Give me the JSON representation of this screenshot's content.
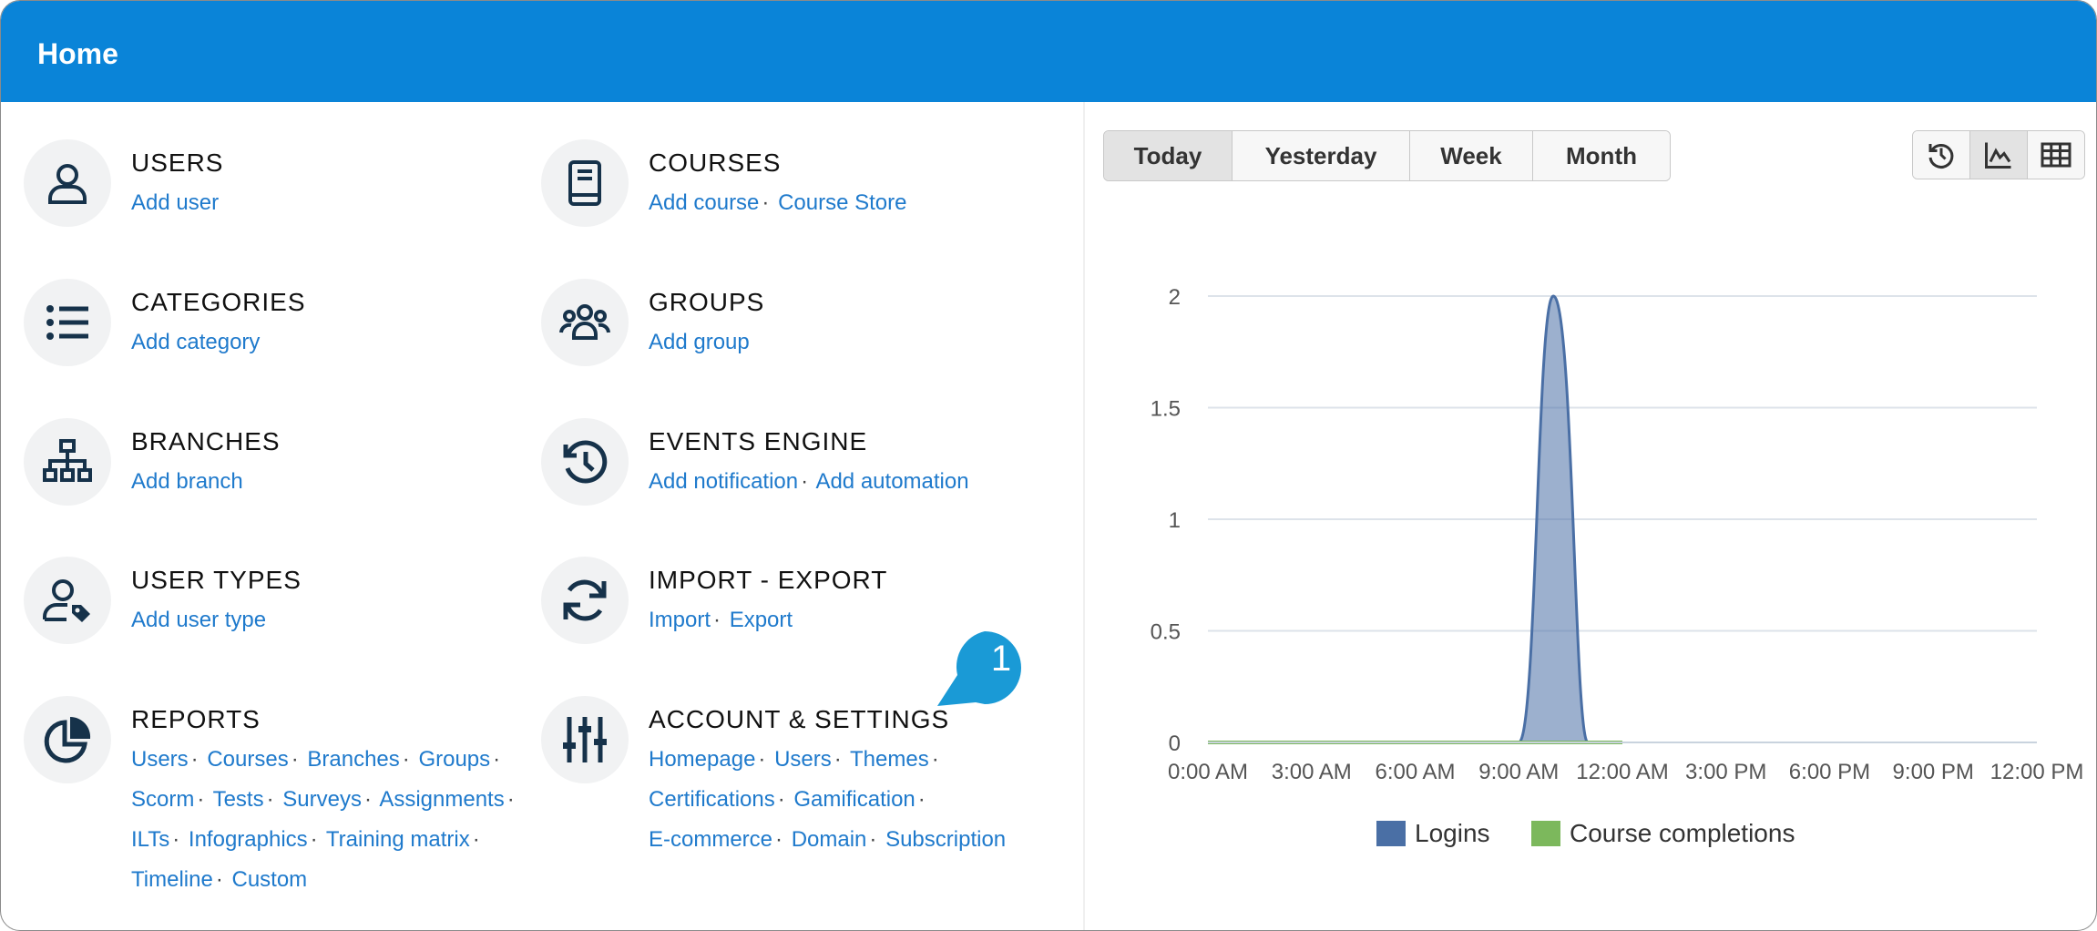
{
  "header": {
    "title": "Home"
  },
  "sections": [
    {
      "key": "users",
      "title": "USERS",
      "icon": "user-icon",
      "links": [
        "Add user"
      ]
    },
    {
      "key": "courses",
      "title": "COURSES",
      "icon": "book-icon",
      "links": [
        "Add course",
        "Course Store"
      ]
    },
    {
      "key": "categories",
      "title": "CATEGORIES",
      "icon": "list-icon",
      "links": [
        "Add category"
      ]
    },
    {
      "key": "groups",
      "title": "GROUPS",
      "icon": "group-icon",
      "links": [
        "Add group"
      ]
    },
    {
      "key": "branches",
      "title": "BRANCHES",
      "icon": "sitemap-icon",
      "links": [
        "Add branch"
      ]
    },
    {
      "key": "events",
      "title": "EVENTS ENGINE",
      "icon": "history-icon",
      "links": [
        "Add notification",
        "Add automation"
      ]
    },
    {
      "key": "usertypes",
      "title": "USER TYPES",
      "icon": "user-tag-icon",
      "links": [
        "Add user type"
      ]
    },
    {
      "key": "importexport",
      "title": "IMPORT - EXPORT",
      "icon": "sync-icon",
      "links": [
        "Import",
        "Export"
      ]
    },
    {
      "key": "reports",
      "title": "REPORTS",
      "icon": "pie-chart-icon",
      "links": [
        "Users",
        "Courses",
        "Branches",
        "Groups",
        "Scorm",
        "Tests",
        "Surveys",
        "Assignments",
        "ILTs",
        "Infographics",
        "Training matrix",
        "Timeline",
        "Custom"
      ]
    },
    {
      "key": "account",
      "title": "ACCOUNT & SETTINGS",
      "icon": "sliders-icon",
      "links": [
        "Homepage",
        "Users",
        "Themes",
        "Certifications",
        "Gamification",
        "E-commerce",
        "Domain",
        "Subscription"
      ]
    }
  ],
  "callout": {
    "number": "1",
    "color": "#1a9ad6"
  },
  "period_tabs": [
    "Today",
    "Yesterday",
    "Week",
    "Month"
  ],
  "active_period": "Today",
  "view_buttons": [
    {
      "icon": "history-icon",
      "active": false
    },
    {
      "icon": "area-chart-icon",
      "active": true
    },
    {
      "icon": "table-icon",
      "active": false
    }
  ],
  "colors": {
    "header": "#0a84d8",
    "link": "#1f7acc",
    "logins": "#4a6fa5",
    "completions": "#7cb85c"
  },
  "chart_data": {
    "type": "area",
    "x": [
      "0:00 AM",
      "3:00 AM",
      "6:00 AM",
      "9:00 AM",
      "12:00 AM",
      "3:00 PM",
      "6:00 PM",
      "9:00 PM",
      "12:00 PM"
    ],
    "yticks": [
      "0",
      "0.5",
      "1",
      "1.5",
      "2"
    ],
    "ylim": [
      0,
      2
    ],
    "grid": true,
    "legend_position": "bottom",
    "series": [
      {
        "name": "Logins",
        "color": "#4a6fa5",
        "points": [
          [
            9.0,
            0
          ],
          [
            10.0,
            2
          ],
          [
            11.0,
            0
          ]
        ]
      },
      {
        "name": "Course completions",
        "color": "#7cb85c",
        "points": [
          [
            0,
            0
          ],
          [
            12.0,
            0
          ]
        ]
      }
    ]
  }
}
